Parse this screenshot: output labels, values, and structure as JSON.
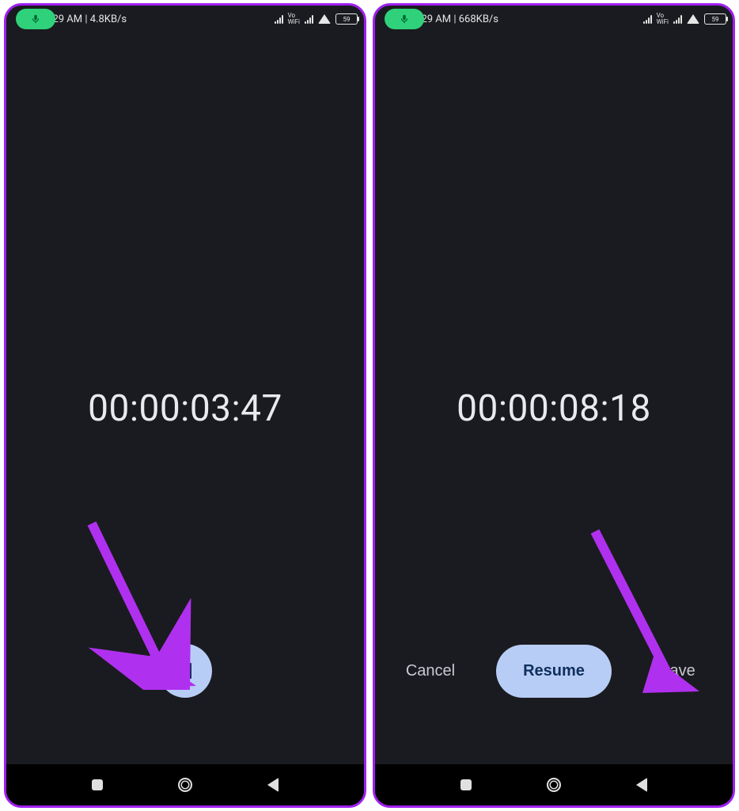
{
  "screens": [
    {
      "status": {
        "time": "6:29 AM",
        "net_speed": "4.8KB/s",
        "vowifi": "Vo\nWiFi",
        "battery": "59"
      },
      "timer": "00:00:03:47",
      "controls": {
        "mode": "running"
      }
    },
    {
      "status": {
        "time": "6:29 AM",
        "net_speed": "668KB/s",
        "vowifi": "Vo\nWiFi",
        "battery": "59"
      },
      "timer": "00:00:08:18",
      "controls": {
        "mode": "paused",
        "cancel_label": "Cancel",
        "resume_label": "Resume",
        "save_label": "Save"
      }
    }
  ],
  "annotation_color": "#b030ef"
}
